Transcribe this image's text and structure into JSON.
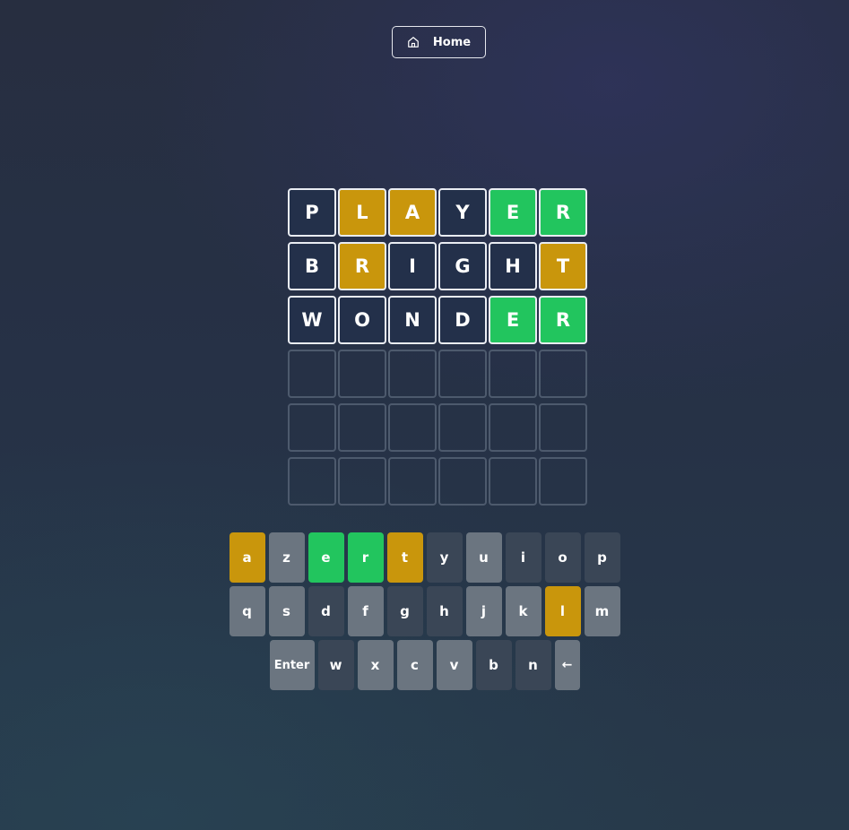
{
  "header": {
    "home_label": "Home",
    "home_icon": "home-icon"
  },
  "colors": {
    "correct": "#22c55e",
    "present": "#c9960c",
    "absent": "#23304a",
    "key_unused": "#6b7580",
    "key_absent": "#3a4656"
  },
  "board": {
    "rows": [
      [
        {
          "letter": "P",
          "state": "absent"
        },
        {
          "letter": "L",
          "state": "present"
        },
        {
          "letter": "A",
          "state": "present"
        },
        {
          "letter": "Y",
          "state": "absent"
        },
        {
          "letter": "E",
          "state": "correct"
        },
        {
          "letter": "R",
          "state": "correct"
        }
      ],
      [
        {
          "letter": "B",
          "state": "absent"
        },
        {
          "letter": "R",
          "state": "present"
        },
        {
          "letter": "I",
          "state": "absent"
        },
        {
          "letter": "G",
          "state": "absent"
        },
        {
          "letter": "H",
          "state": "absent"
        },
        {
          "letter": "T",
          "state": "present"
        }
      ],
      [
        {
          "letter": "W",
          "state": "absent"
        },
        {
          "letter": "O",
          "state": "absent"
        },
        {
          "letter": "N",
          "state": "absent"
        },
        {
          "letter": "D",
          "state": "absent"
        },
        {
          "letter": "E",
          "state": "correct"
        },
        {
          "letter": "R",
          "state": "correct"
        }
      ],
      [
        {
          "letter": "",
          "state": "empty"
        },
        {
          "letter": "",
          "state": "empty"
        },
        {
          "letter": "",
          "state": "empty"
        },
        {
          "letter": "",
          "state": "empty"
        },
        {
          "letter": "",
          "state": "empty"
        },
        {
          "letter": "",
          "state": "empty"
        }
      ],
      [
        {
          "letter": "",
          "state": "empty"
        },
        {
          "letter": "",
          "state": "empty"
        },
        {
          "letter": "",
          "state": "empty"
        },
        {
          "letter": "",
          "state": "empty"
        },
        {
          "letter": "",
          "state": "empty"
        },
        {
          "letter": "",
          "state": "empty"
        }
      ],
      [
        {
          "letter": "",
          "state": "empty"
        },
        {
          "letter": "",
          "state": "empty"
        },
        {
          "letter": "",
          "state": "empty"
        },
        {
          "letter": "",
          "state": "empty"
        },
        {
          "letter": "",
          "state": "empty"
        },
        {
          "letter": "",
          "state": "empty"
        }
      ]
    ]
  },
  "keyboard": {
    "rows": [
      [
        {
          "label": "a",
          "state": "present"
        },
        {
          "label": "z",
          "state": "unused"
        },
        {
          "label": "e",
          "state": "correct"
        },
        {
          "label": "r",
          "state": "correct"
        },
        {
          "label": "t",
          "state": "present"
        },
        {
          "label": "y",
          "state": "absent"
        },
        {
          "label": "u",
          "state": "unused"
        },
        {
          "label": "i",
          "state": "absent"
        },
        {
          "label": "o",
          "state": "absent"
        },
        {
          "label": "p",
          "state": "absent"
        }
      ],
      [
        {
          "label": "q",
          "state": "unused"
        },
        {
          "label": "s",
          "state": "unused"
        },
        {
          "label": "d",
          "state": "absent"
        },
        {
          "label": "f",
          "state": "unused"
        },
        {
          "label": "g",
          "state": "absent"
        },
        {
          "label": "h",
          "state": "absent"
        },
        {
          "label": "j",
          "state": "unused"
        },
        {
          "label": "k",
          "state": "unused"
        },
        {
          "label": "l",
          "state": "present"
        },
        {
          "label": "m",
          "state": "unused"
        }
      ],
      [
        {
          "label": "Enter",
          "state": "unused",
          "kind": "enter"
        },
        {
          "label": "w",
          "state": "absent"
        },
        {
          "label": "x",
          "state": "unused"
        },
        {
          "label": "c",
          "state": "unused"
        },
        {
          "label": "v",
          "state": "unused"
        },
        {
          "label": "b",
          "state": "absent"
        },
        {
          "label": "n",
          "state": "absent"
        },
        {
          "label": "←",
          "state": "unused",
          "kind": "backspace"
        }
      ]
    ]
  }
}
